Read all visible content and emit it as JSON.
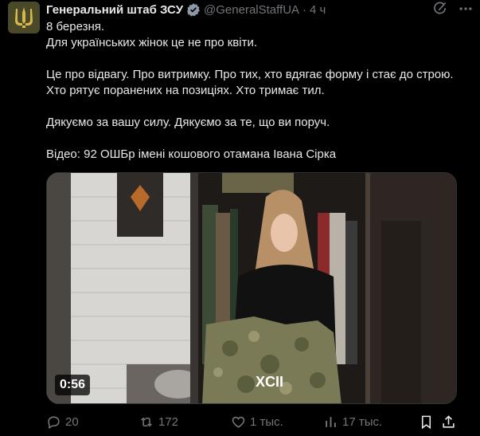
{
  "author": {
    "name": "Генеральний штаб ЗСУ",
    "handle": "@GeneralStaffUA",
    "separator": "·",
    "time": "4 ч"
  },
  "body": {
    "line1": "8 березня.",
    "line2": "Для українських жінок це не про квіти.",
    "line3": "Це про відвагу. Про витримку. Про тих, хто вдягає форму і стає до строю. Хто рятує поранених на позиціях. Хто тримає тил.",
    "line4": "Дякуємо за вашу силу. Дякуємо за те, що ви поруч.",
    "line5": "Відео: 92 ОШБр імені кошового отамана Івана Сірка"
  },
  "media": {
    "duration": "0:56",
    "overlay_logo": "XCII"
  },
  "actions": {
    "replies": "20",
    "reposts": "172",
    "likes": "1 тыс.",
    "views": "17 тыс."
  },
  "colors": {
    "text": "#e7e9ea",
    "muted": "#71767b",
    "verified": "#8b98a5",
    "background": "#000000"
  },
  "icons": [
    "trident-icon",
    "verified-icon",
    "grok-icon",
    "more-icon",
    "reply-icon",
    "repost-icon",
    "like-icon",
    "views-icon",
    "bookmark-icon",
    "share-icon"
  ]
}
